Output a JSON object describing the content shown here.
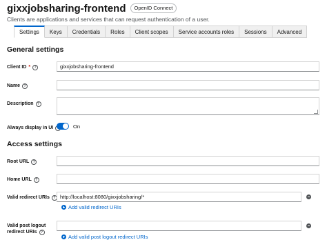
{
  "header": {
    "title": "gixxjobsharing-frontend",
    "badge": "OpenID Connect",
    "subtitle": "Clients are applications and services that can request authentication of a user."
  },
  "tabs": [
    {
      "label": "Settings",
      "active": true
    },
    {
      "label": "Keys"
    },
    {
      "label": "Credentials"
    },
    {
      "label": "Roles"
    },
    {
      "label": "Client scopes"
    },
    {
      "label": "Service accounts roles"
    },
    {
      "label": "Sessions"
    },
    {
      "label": "Advanced"
    }
  ],
  "general": {
    "heading": "General settings",
    "client_id_label": "Client ID",
    "required_mark": "*",
    "client_id_value": "gixxjobsharing-frontend",
    "name_label": "Name",
    "name_value": "",
    "description_label": "Description",
    "description_value": "",
    "display_label": "Always display in UI",
    "display_state": "On"
  },
  "access": {
    "heading": "Access settings",
    "root_url_label": "Root URL",
    "root_url_value": "",
    "home_url_label": "Home URL",
    "home_url_value": "",
    "redirect_label": "Valid redirect URIs",
    "redirect_value": "http://localhost:8080/gixxjobsharing/*",
    "add_redirect": "Add valid redirect URIs",
    "post_logout_label_1": "Valid post logout",
    "post_logout_label_2": "redirect URIs",
    "post_logout_value": "",
    "add_post_logout": "Add valid post logout redirect URIs"
  },
  "colors": {
    "accent": "#0066cc",
    "danger": "#c9190b"
  }
}
